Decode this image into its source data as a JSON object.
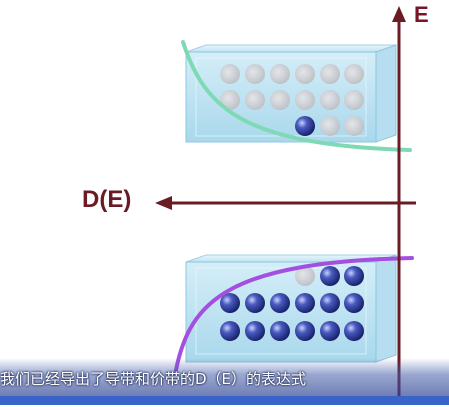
{
  "diagram": {
    "energy_axis_label": "E",
    "dos_axis_label": "D(E)",
    "conduction_band": {
      "filled_electrons": 1
    },
    "valence_band": {
      "filled_electrons": 15,
      "empty_holes": 1
    },
    "colors": {
      "axis": "#6b1b24",
      "conduction_curve": "#7fd9b5",
      "valence_curve": "#a44fe0",
      "electron": "#2a3a9a",
      "empty_state": "#c9ccd0"
    }
  },
  "subtitle": "我们已经导出了导带和价带的D（E）的表达式"
}
